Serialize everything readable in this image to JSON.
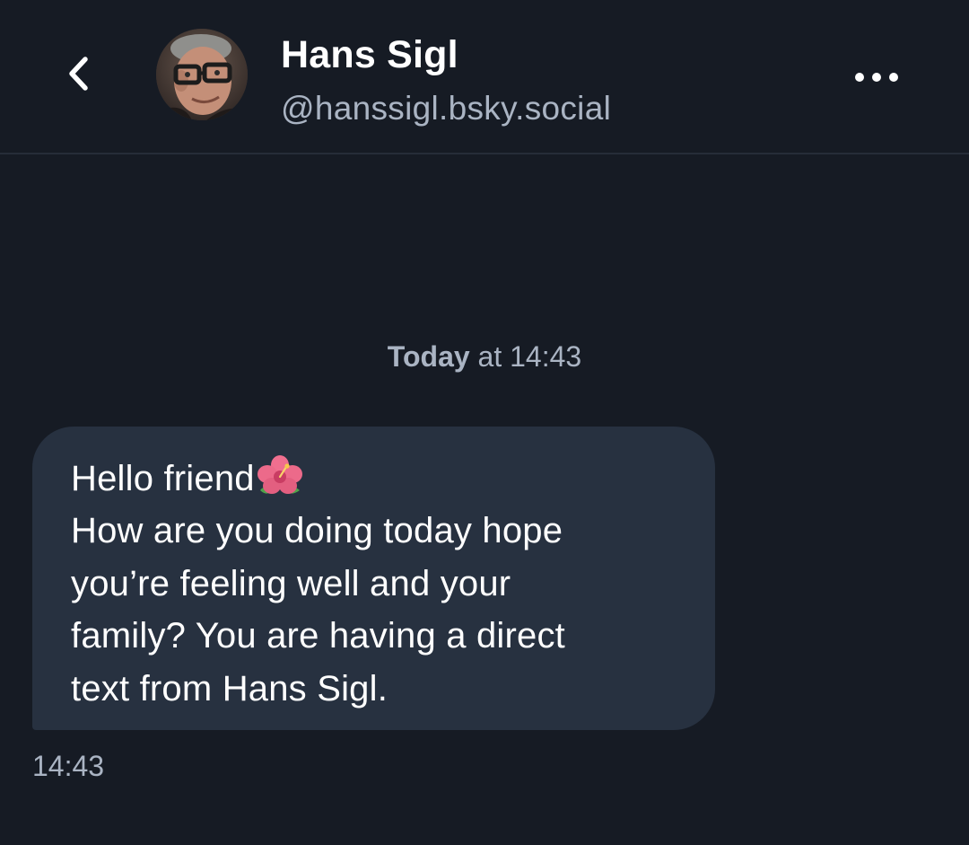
{
  "header": {
    "display_name": "Hans Sigl",
    "handle": "@hanssigl.bsky.social",
    "back_icon": "chevron-left-icon",
    "more_icon": "more-horizontal-icon"
  },
  "conversation": {
    "date_separator": {
      "day": "Today",
      "rest": "at 14:43"
    },
    "messages": [
      {
        "lines": [
          "Hello friend",
          "How are you doing today hope",
          "you’re feeling well and your",
          "family? You are having a direct",
          "text from Hans Sigl."
        ],
        "emoji": "hibiscus-emoji",
        "time": "14:43"
      }
    ]
  },
  "colors": {
    "background": "#161b24",
    "bubble": "#273140",
    "secondary_text": "#aab4c3",
    "divider": "#262d38"
  }
}
